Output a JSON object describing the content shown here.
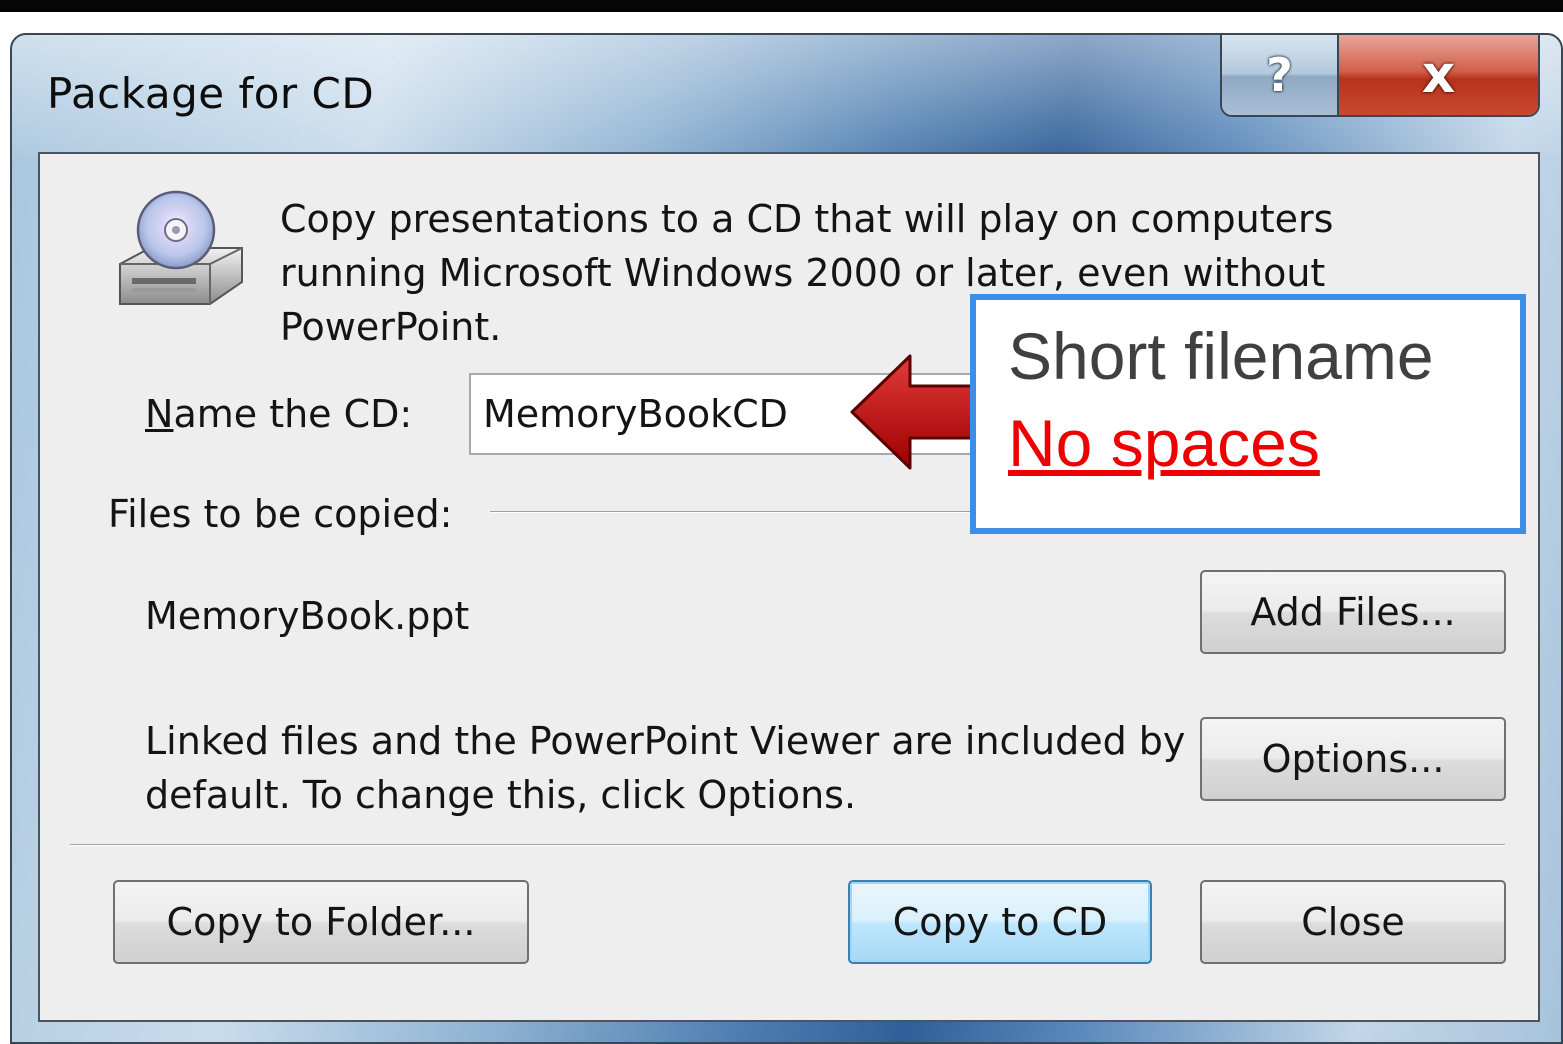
{
  "window": {
    "title": "Package for CD",
    "help_glyph": "?",
    "close_glyph": "x"
  },
  "dialog": {
    "intro_text": "Copy presentations to a CD that will play on computers running Microsoft Windows 2000 or later, even without PowerPoint.",
    "name_label_mnemonic": "N",
    "name_label_rest": "ame the CD:",
    "name_value": "MemoryBookCD",
    "files_label": "Files to be copied:",
    "files": [
      "MemoryBook.ppt"
    ],
    "note_text": "Linked files and the PowerPoint Viewer are included by default. To change this, click Options."
  },
  "buttons": {
    "add_files": "Add Files...",
    "options": "Options...",
    "copy_to_folder": "Copy to Folder...",
    "copy_to_cd": "Copy to CD",
    "close": "Close"
  },
  "annotation": {
    "line1": "Short filename",
    "line2": "No spaces",
    "arrow_color": "#cc0000",
    "border_color": "#3d8ee8",
    "line2_color": "#ee0000"
  },
  "icons": {
    "cd_drive": "cd-drive-icon",
    "arrow": "left-arrow-icon"
  }
}
